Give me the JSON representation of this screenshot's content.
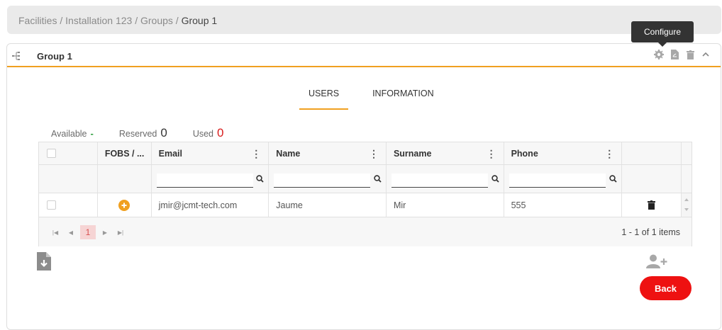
{
  "breadcrumb": {
    "items": [
      "Facilities",
      "Installation 123",
      "Groups"
    ],
    "separator": " / ",
    "current": "Group 1"
  },
  "card": {
    "title": "Group 1",
    "tooltip": "Configure",
    "icons": [
      "tree-icon",
      "gear-icon",
      "pdf-icon",
      "trash-icon",
      "chevron-up-icon"
    ]
  },
  "tabs": [
    {
      "label": "USERS",
      "active": true
    },
    {
      "label": "INFORMATION",
      "active": false
    }
  ],
  "stats": {
    "available": {
      "label": "Available",
      "value": "-"
    },
    "reserved": {
      "label": "Reserved",
      "value": "0"
    },
    "used": {
      "label": "Used",
      "value": "0"
    }
  },
  "table": {
    "columns": [
      "FOBS / ...",
      "Email",
      "Name",
      "Surname",
      "Phone"
    ],
    "filter_placeholders": [
      "",
      "",
      "",
      ""
    ],
    "rows": [
      {
        "email": "jmir@jcmt-tech.com",
        "name": "Jaume",
        "surname": "Mir",
        "phone": "555"
      }
    ]
  },
  "pager": {
    "current_page": "1",
    "info": "1 - 1 of 1 items"
  },
  "actions": {
    "back": "Back"
  },
  "colors": {
    "accent": "#f0a020",
    "danger": "#ee1111",
    "used": "#d81c1c",
    "available": "#2e9e3e"
  }
}
